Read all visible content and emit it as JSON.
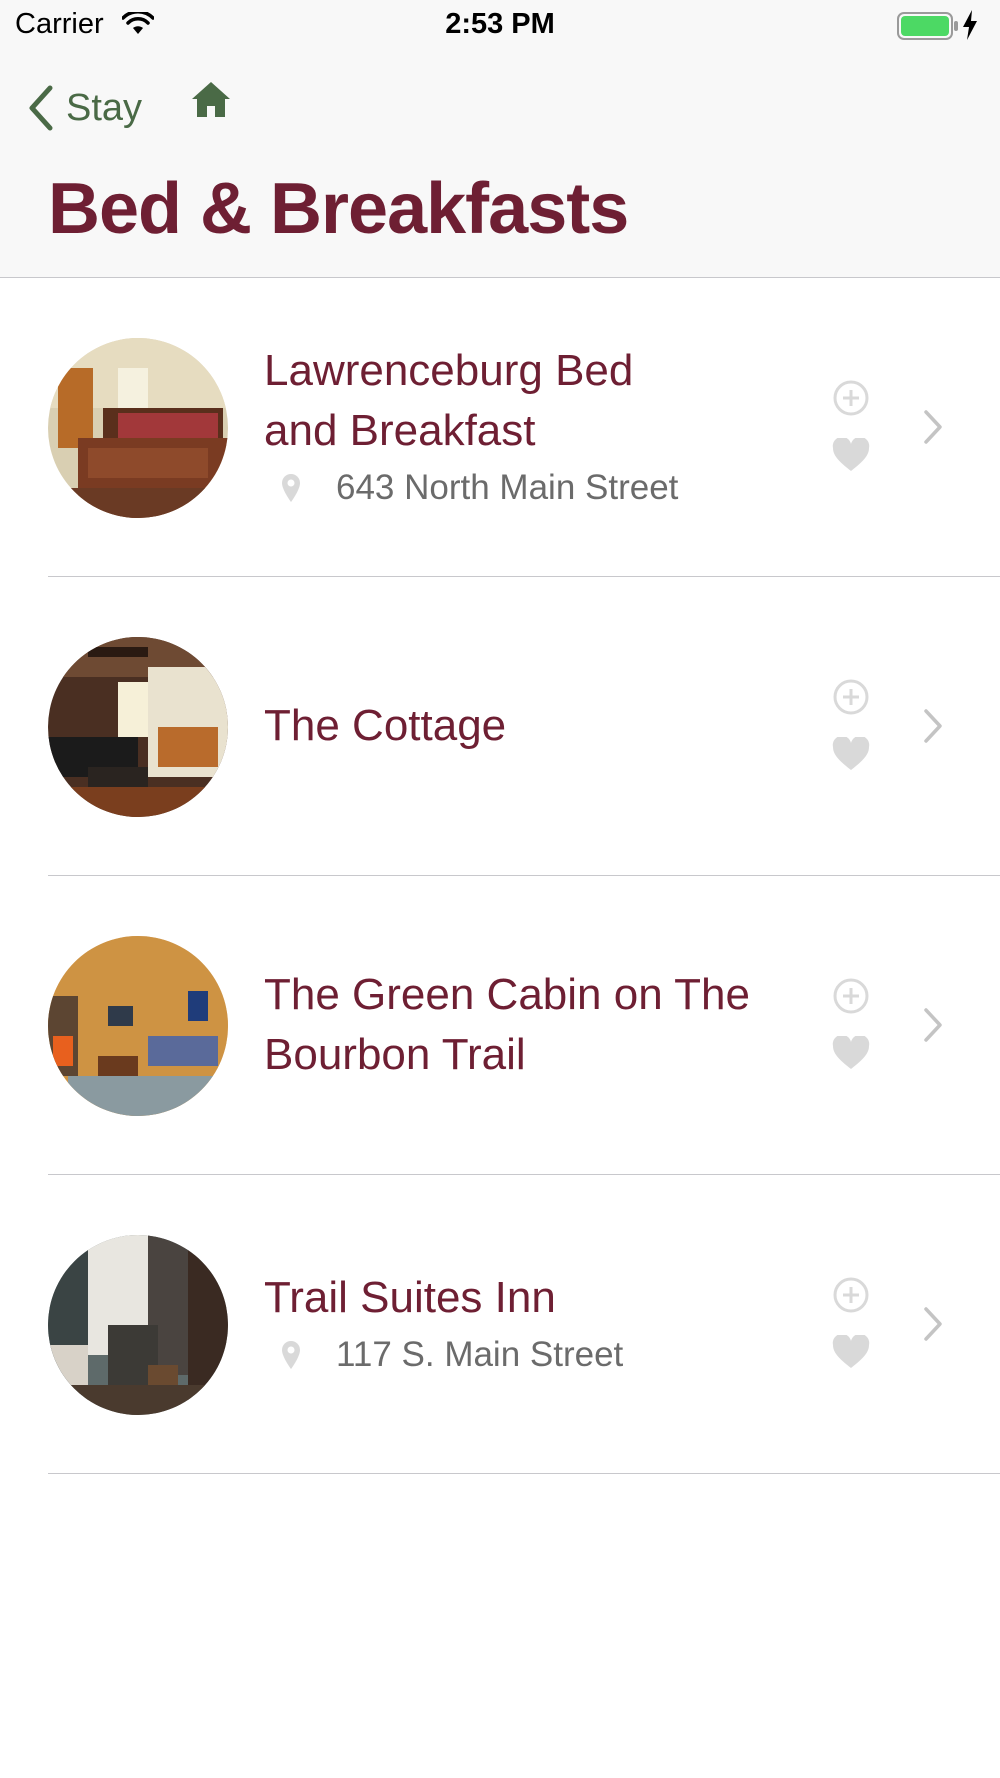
{
  "status_bar": {
    "carrier": "Carrier",
    "time": "2:53 PM"
  },
  "nav": {
    "back_label": "Stay",
    "title": "Bed & Breakfasts"
  },
  "colors": {
    "accent": "#4a6a46",
    "title": "#6e1f33",
    "icon_muted": "#d9d9d9",
    "battery": "#4cd964"
  },
  "items": [
    {
      "name": "Lawrenceburg Bed and Breakfast",
      "name_lines": [
        "Lawrenceburg Bed",
        "and Breakfast"
      ],
      "address": "643 North Main Street"
    },
    {
      "name": "The Cottage",
      "name_lines": [
        "The Cottage"
      ],
      "address": ""
    },
    {
      "name": "The Green Cabin on The Bourbon Trail",
      "name_lines": [
        "The Green Cabin on The",
        "Bourbon Trail"
      ],
      "address": ""
    },
    {
      "name": "Trail Suites Inn",
      "name_lines": [
        "Trail Suites Inn"
      ],
      "address": "117 S. Main Street"
    }
  ]
}
